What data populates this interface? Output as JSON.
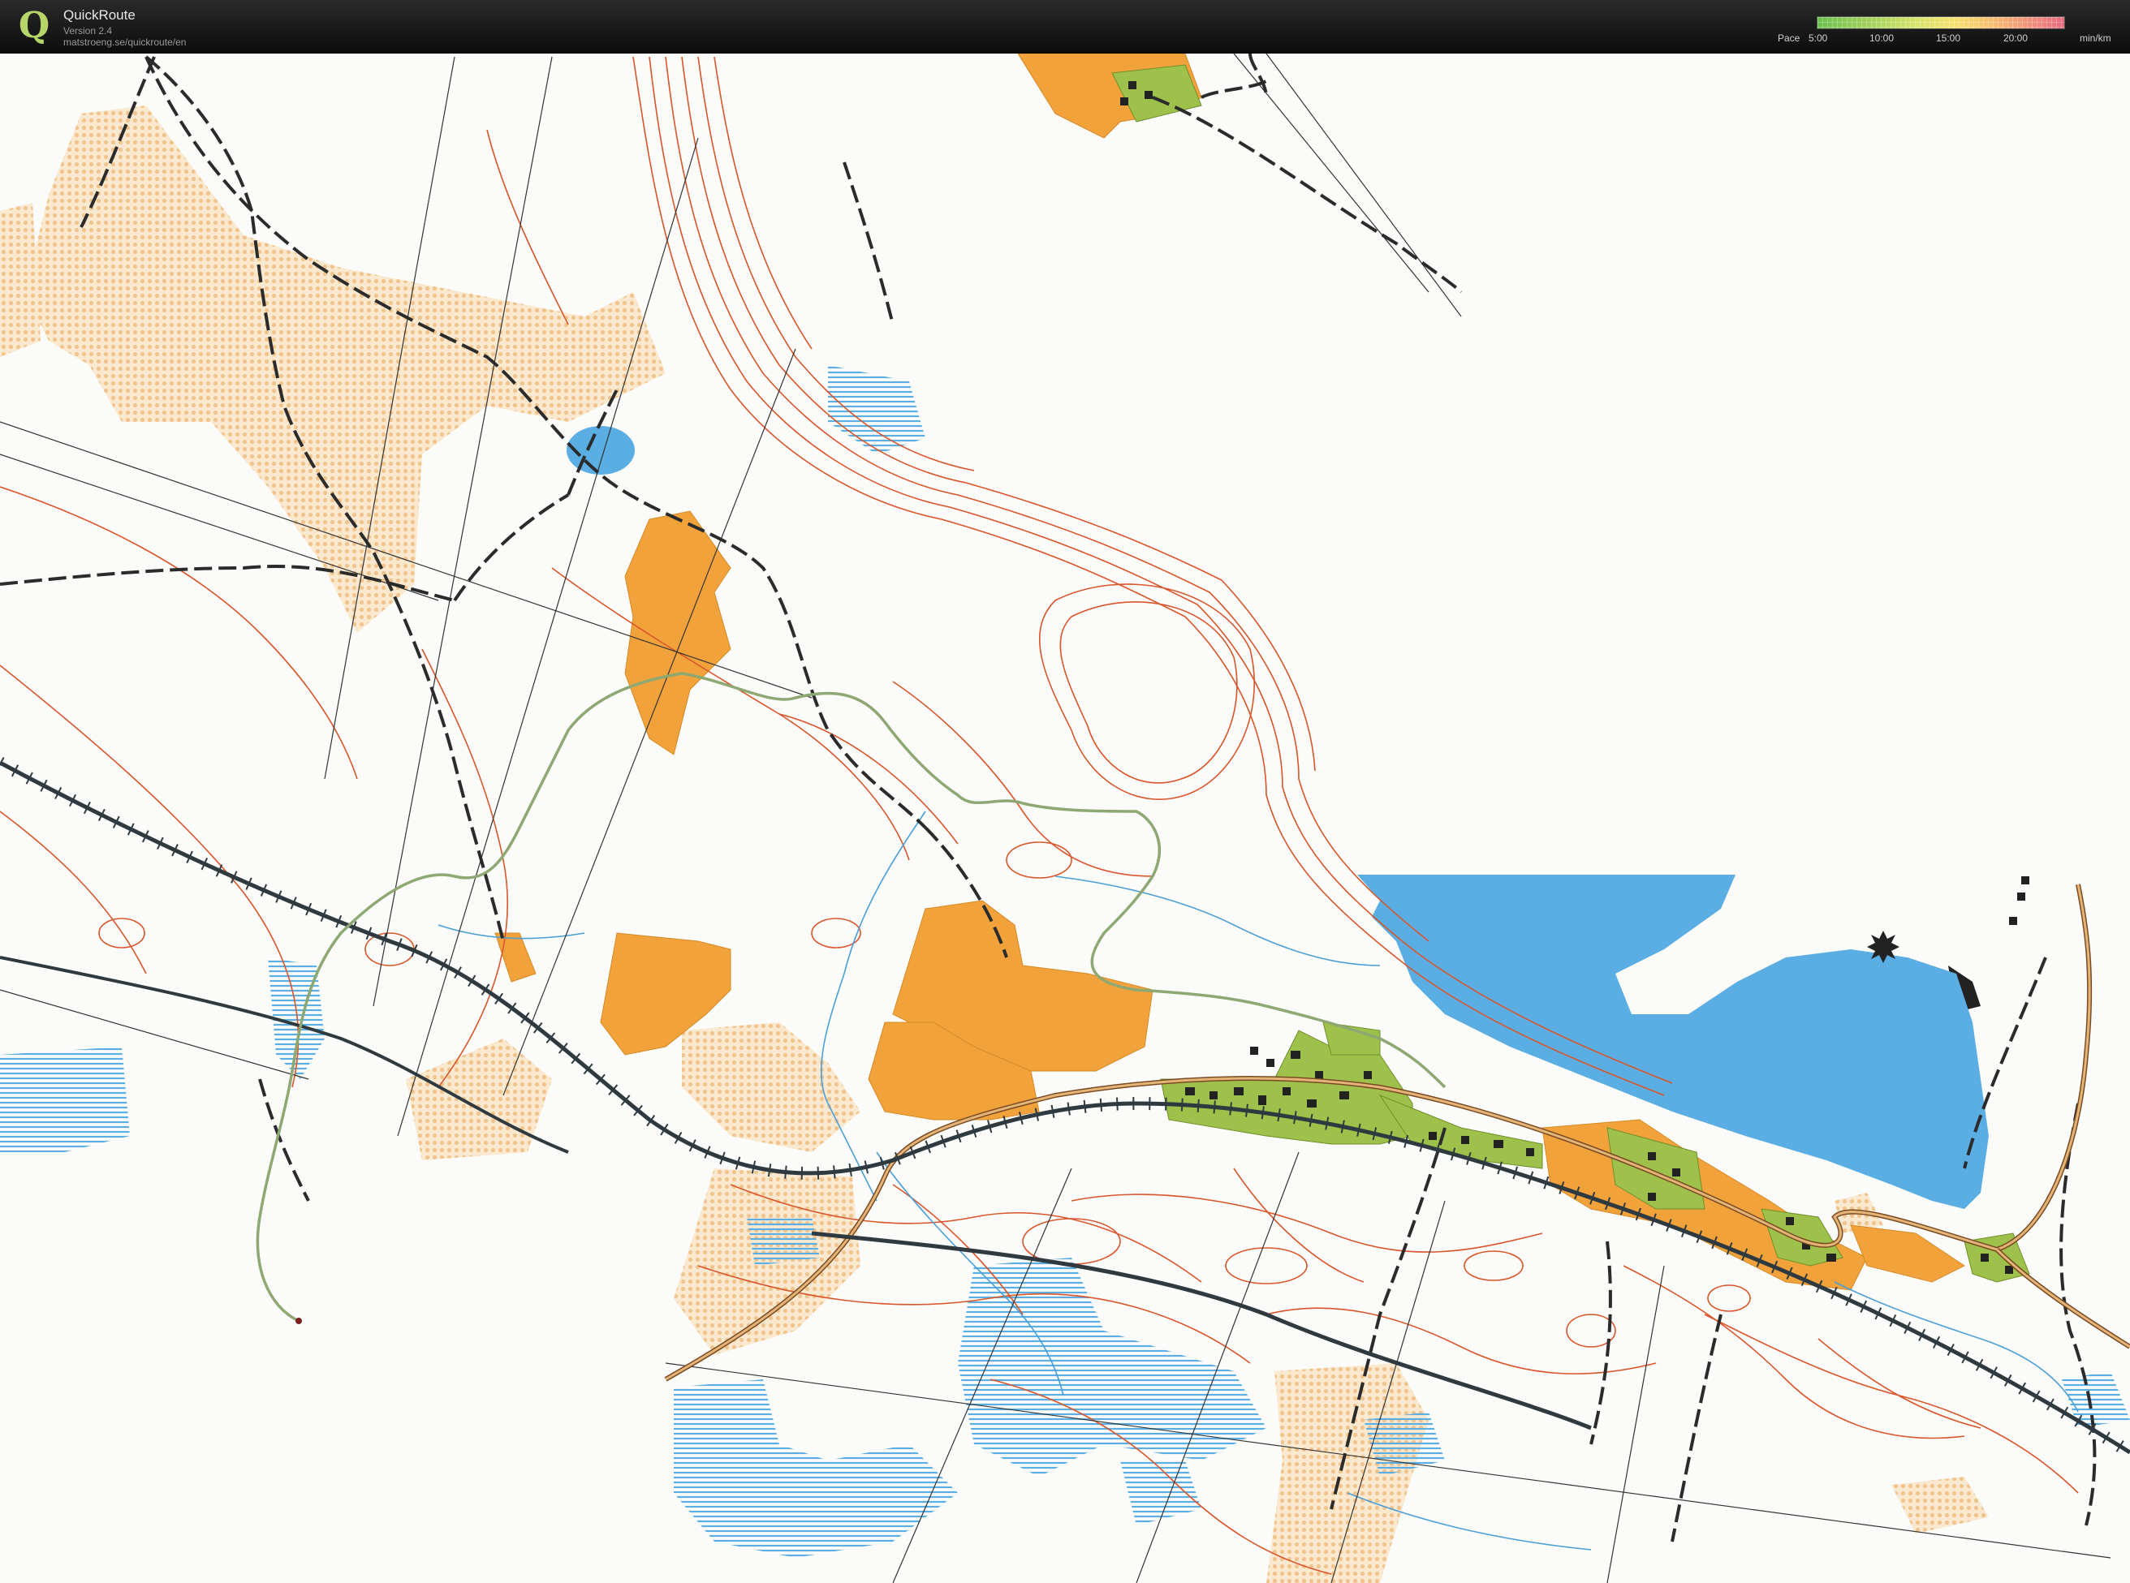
{
  "app": {
    "name": "QuickRoute",
    "version": "Version 2.4",
    "url": "matstroeng.se/quickroute/en",
    "logo_letter": "Q"
  },
  "pace_legend": {
    "label": "Pace",
    "ticks": [
      "5:00",
      "10:00",
      "15:00",
      "20:00"
    ],
    "unit": "min/km",
    "colors": [
      "#6bbf4e",
      "#9fd05a",
      "#d7e36a",
      "#f5e36e",
      "#f7bb70",
      "#f08a7c",
      "#e86a80"
    ]
  },
  "map": {
    "colors": {
      "contour": "#d9552a",
      "open_land": "#f2a23a",
      "rough_open": "#f4d5a8",
      "water": "#5aaee3",
      "marsh": "#7bbde8",
      "path": "#2b2b2b",
      "railway": "#2e3a40",
      "settlement": "#9dc14a",
      "building": "#222222",
      "route": "#8da872"
    },
    "features": [
      "contours",
      "open land",
      "lake",
      "marsh",
      "paths",
      "railway",
      "settlement",
      "GPS route"
    ]
  }
}
